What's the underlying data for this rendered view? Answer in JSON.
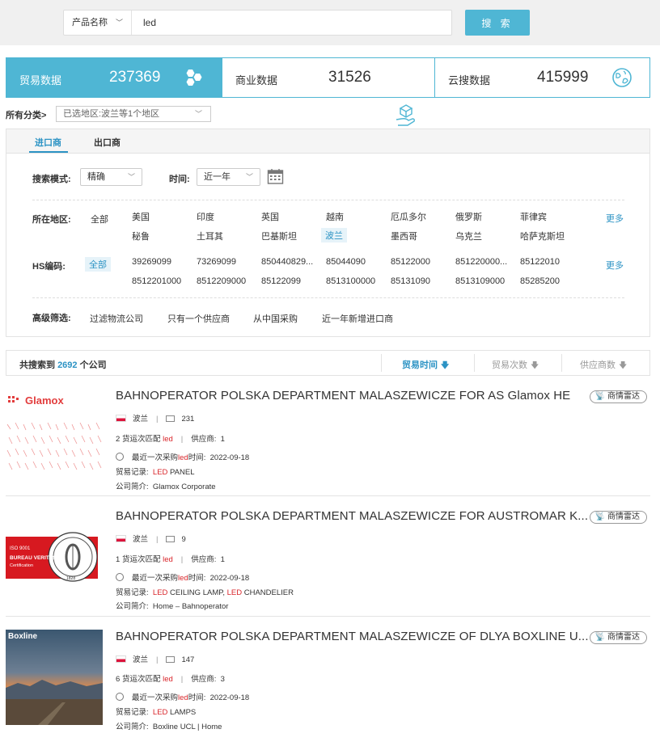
{
  "search": {
    "select_label": "产品名称",
    "query": "led",
    "button": "搜 索"
  },
  "stats": [
    {
      "label": "贸易数据",
      "value": "237369",
      "icon": "hexagon-cluster-icon"
    },
    {
      "label": "商业数据",
      "value": "31526",
      "icon": ""
    },
    {
      "label": "云搜数据",
      "value": "415999",
      "icon": "globe-icon"
    }
  ],
  "category": {
    "label": "所有分类>",
    "selected": "已选地区:波兰等1个地区"
  },
  "tabs": [
    "进口商",
    "出口商"
  ],
  "filters": {
    "mode_label": "搜索模式:",
    "mode_value": "精确",
    "time_label": "时间:",
    "time_value": "近一年",
    "region_label": "所在地区:",
    "region_all": "全部",
    "regions_row1": [
      "美国",
      "印度",
      "英国",
      "越南",
      "厄瓜多尔",
      "俄罗斯",
      "菲律宾"
    ],
    "regions_row2": [
      "秘鲁",
      "土耳其",
      "巴基斯坦",
      "波兰",
      "墨西哥",
      "乌克兰",
      "哈萨克斯坦"
    ],
    "hs_label": "HS编码:",
    "hs_all": "全部",
    "hs_row1": [
      "39269099",
      "73269099",
      "850440829...",
      "85044090",
      "85122000",
      "851220000...",
      "85122010"
    ],
    "hs_row2": [
      "8512201000",
      "8512209000",
      "85122099",
      "8513100000",
      "85131090",
      "8513109000",
      "85285200"
    ],
    "more": "更多",
    "adv_label": "高级筛选:",
    "adv_options": [
      "过滤物流公司",
      "只有一个供应商",
      "从中国采购",
      "近一年新增进口商"
    ]
  },
  "results": {
    "prefix": "共搜索到",
    "count": "2692",
    "suffix": "个公司",
    "sort": [
      "贸易时间",
      "贸易次数",
      "供应商数"
    ]
  },
  "labels": {
    "radar": "商情雷达",
    "shipments_suffix": "货运次匹配",
    "suppliers": "供应商:",
    "last_purchase_pre": "最近一次采购",
    "last_purchase_post": "时间:",
    "record": "贸易记录:",
    "intro": "公司简介:"
  },
  "companies": [
    {
      "name": "BAHNOPERATOR POLSKA DEPARTMENT MALASZEWICZE FOR AS Glamox HE",
      "country": "波兰",
      "mail_count": "231",
      "shipments": "2",
      "keyword": "led",
      "suppliers": "1",
      "date": "2022-09-18",
      "record_hl": "LED",
      "record_rest": " PANEL",
      "intro": "Glamox Corporate",
      "logo_text": "Glamox"
    },
    {
      "name": "BAHNOPERATOR POLSKA DEPARTMENT MALASZEWICZE FOR AUSTROMAR K...",
      "country": "波兰",
      "mail_count": "9",
      "shipments": "1",
      "keyword": "led",
      "suppliers": "1",
      "date": "2022-09-18",
      "record_hl": "LED",
      "record_rest": " CEILING LAMP, ",
      "record_hl2": "LED",
      "record_rest2": " CHANDELIER",
      "intro": "Home – Bahnoperator",
      "logo_lines": [
        "ISO 9001",
        "BUREAU VERITAS",
        "Certification",
        "1828"
      ]
    },
    {
      "name": "BAHNOPERATOR POLSKA DEPARTMENT MALASZEWICZE OF DLYA BOXLINE U...",
      "country": "波兰",
      "mail_count": "147",
      "shipments": "6",
      "keyword": "led",
      "suppliers": "3",
      "date": "2022-09-18",
      "record_hl": "LED",
      "record_rest": " LAMPS",
      "intro": "Boxline UCL | Home",
      "logo_text": "Boxline"
    }
  ],
  "colors": {
    "accent": "#4fb6d4",
    "link": "#2c93c4",
    "highlight": "#d9252a"
  }
}
